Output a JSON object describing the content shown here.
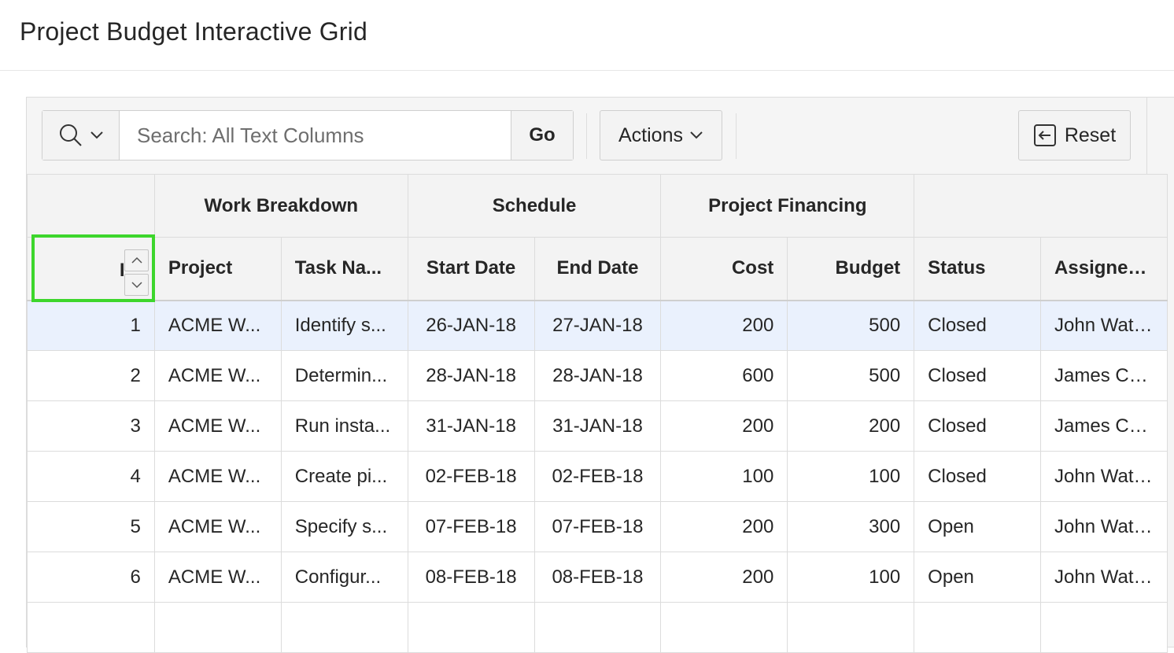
{
  "page": {
    "title": "Project Budget Interactive Grid"
  },
  "toolbar": {
    "search_icon": "search-icon",
    "search_placeholder": "Search: All Text Columns",
    "search_value": "",
    "go_label": "Go",
    "actions_label": "Actions",
    "reset_label": "Reset"
  },
  "grid": {
    "groups": [
      "Work Breakdown",
      "Schedule",
      "Project Financing"
    ],
    "columns": [
      "Project",
      "Task Na...",
      "Start Date",
      "End Date",
      "Cost",
      "Budget",
      "Status",
      "Assigned..."
    ],
    "row_header_fragment": "I",
    "rows": [
      {
        "no": "1",
        "project": "ACME W...",
        "task": "Identify s...",
        "start": "26-JAN-18",
        "end": "27-JAN-18",
        "cost": "200",
        "budget": "500",
        "status": "Closed",
        "assigned": "John Wats..."
      },
      {
        "no": "2",
        "project": "ACME W...",
        "task": "Determin...",
        "start": "28-JAN-18",
        "end": "28-JAN-18",
        "cost": "600",
        "budget": "500",
        "status": "Closed",
        "assigned": "James Ca..."
      },
      {
        "no": "3",
        "project": "ACME W...",
        "task": "Run insta...",
        "start": "31-JAN-18",
        "end": "31-JAN-18",
        "cost": "200",
        "budget": "200",
        "status": "Closed",
        "assigned": "James Ca..."
      },
      {
        "no": "4",
        "project": "ACME W...",
        "task": "Create pi...",
        "start": "02-FEB-18",
        "end": "02-FEB-18",
        "cost": "100",
        "budget": "100",
        "status": "Closed",
        "assigned": "John Wats..."
      },
      {
        "no": "5",
        "project": "ACME W...",
        "task": "Specify s...",
        "start": "07-FEB-18",
        "end": "07-FEB-18",
        "cost": "200",
        "budget": "300",
        "status": "Open",
        "assigned": "John Wats..."
      },
      {
        "no": "6",
        "project": "ACME W...",
        "task": "Configur...",
        "start": "08-FEB-18",
        "end": "08-FEB-18",
        "cost": "200",
        "budget": "100",
        "status": "Open",
        "assigned": "John Wats..."
      },
      {
        "no": "",
        "project": "",
        "task": "",
        "start": "",
        "end": "",
        "cost": "",
        "budget": "",
        "status": "",
        "assigned": ""
      }
    ]
  },
  "colors": {
    "focus_ring": "#3dd62c",
    "selected_row": "#eaf1fd",
    "header_bg": "#f3f3f3"
  }
}
